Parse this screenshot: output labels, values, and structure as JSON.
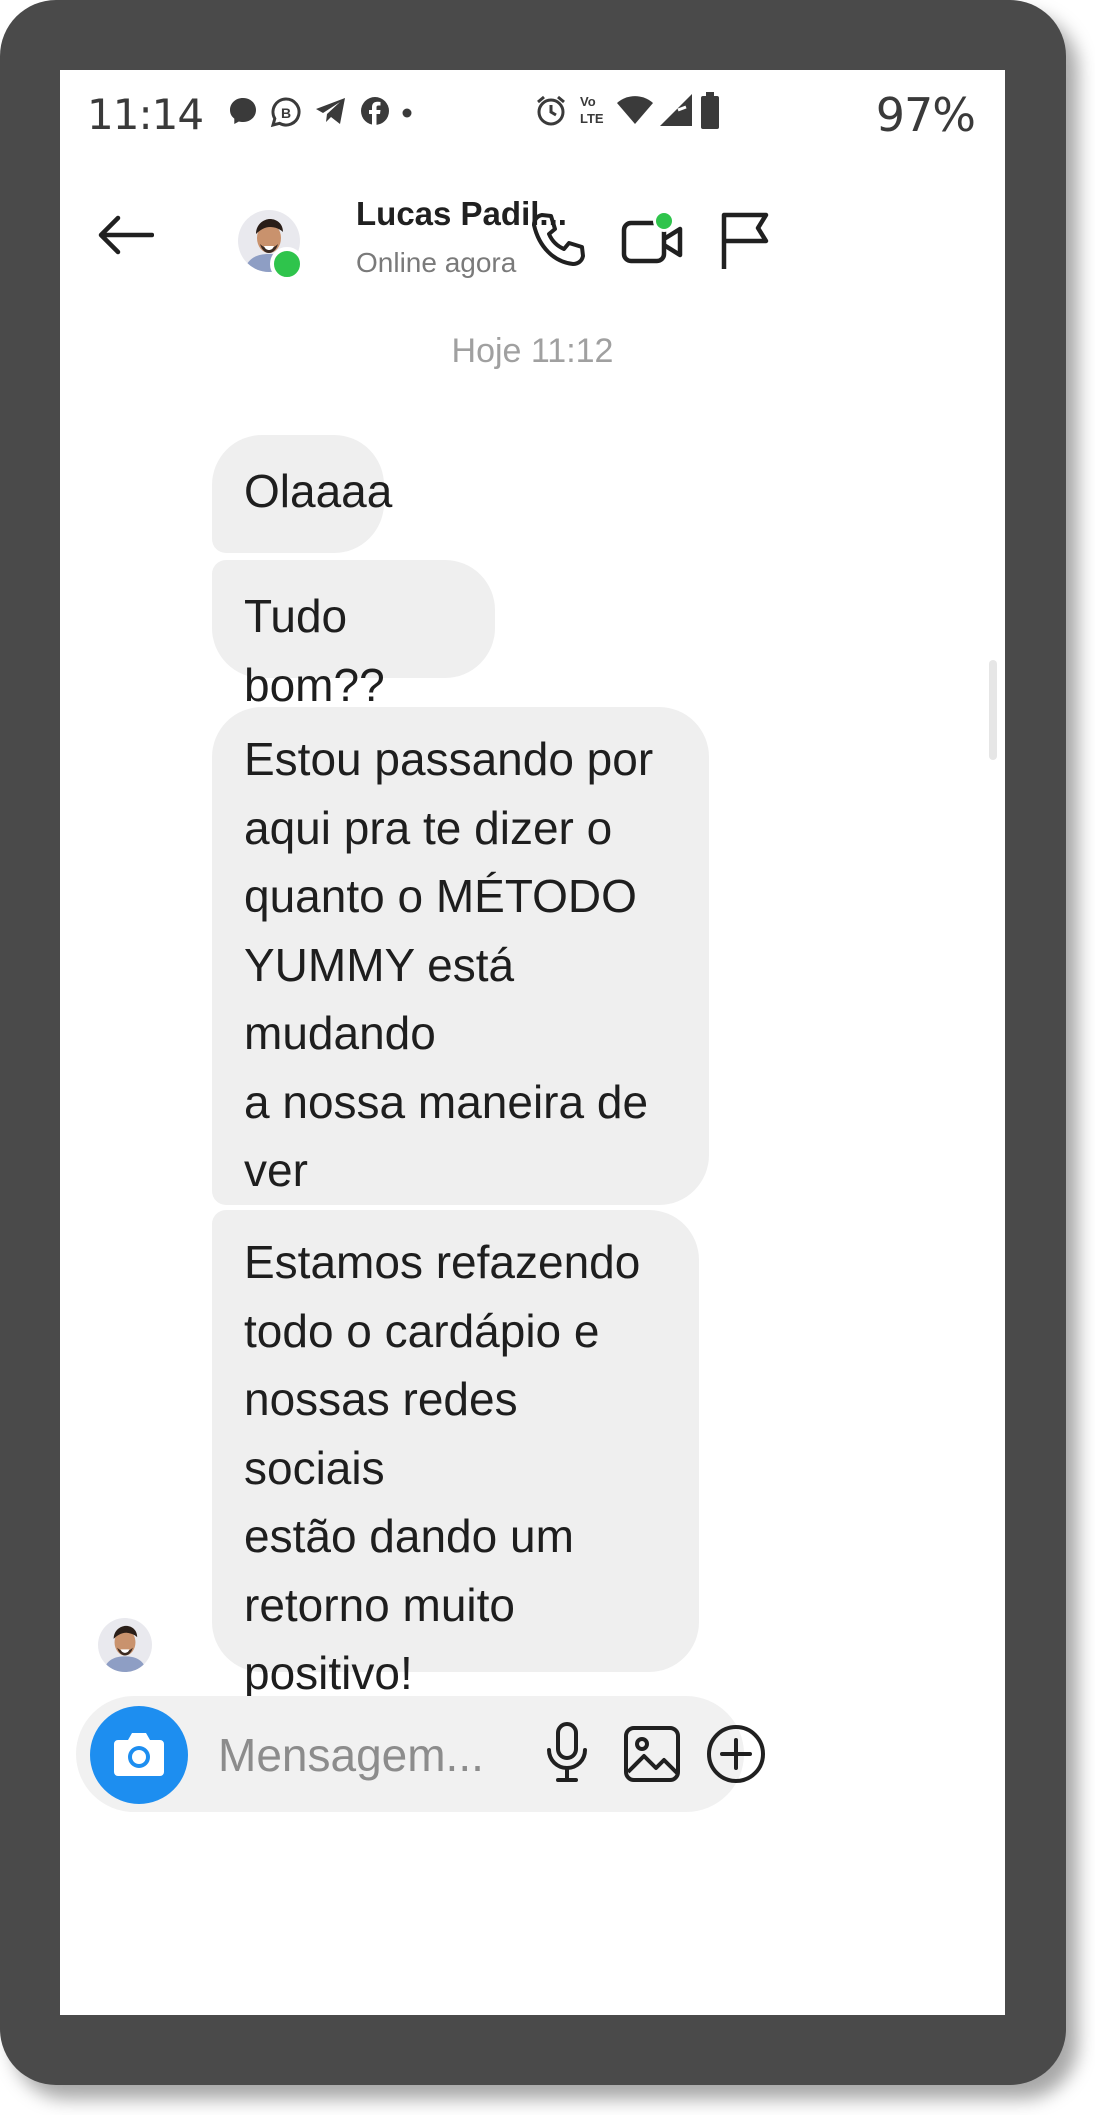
{
  "status_bar": {
    "time": "11:14",
    "battery": "97%",
    "notification_icons": [
      "messenger-icon",
      "whatsapp-business-icon",
      "telegram-icon",
      "facebook-icon",
      "dot-icon"
    ],
    "system_icons": [
      "alarm-icon",
      "volte-icon",
      "wifi-icon",
      "signal-icon",
      "battery-icon"
    ]
  },
  "header": {
    "contact_name": "Lucas Padil...",
    "presence": "Online agora"
  },
  "conversation": {
    "timestamp": "Hoje 11:12",
    "messages": [
      {
        "text": "Olaaaa"
      },
      {
        "text": "Tudo bom??"
      },
      {
        "text": "Estou passando por\naqui pra te dizer o\nquanto o MÉTODO\nYUMMY está mudando\na nossa maneira de ver\no nosso restaurante.\nEstamos super\nempolgados em evoluir\nna nossa divulgação."
      },
      {
        "text": "Estamos refazendo\ntodo o cardápio e\nnossas redes sociais\nestão dando um\nretorno muito positivo!\nObg, Lú!!!!"
      }
    ]
  },
  "composer": {
    "placeholder": "Mensagem..."
  },
  "colors": {
    "frame": "#4a4a4a",
    "bubble": "#efefef",
    "online": "#2fc44c",
    "camera_button": "#1d8ef0"
  }
}
